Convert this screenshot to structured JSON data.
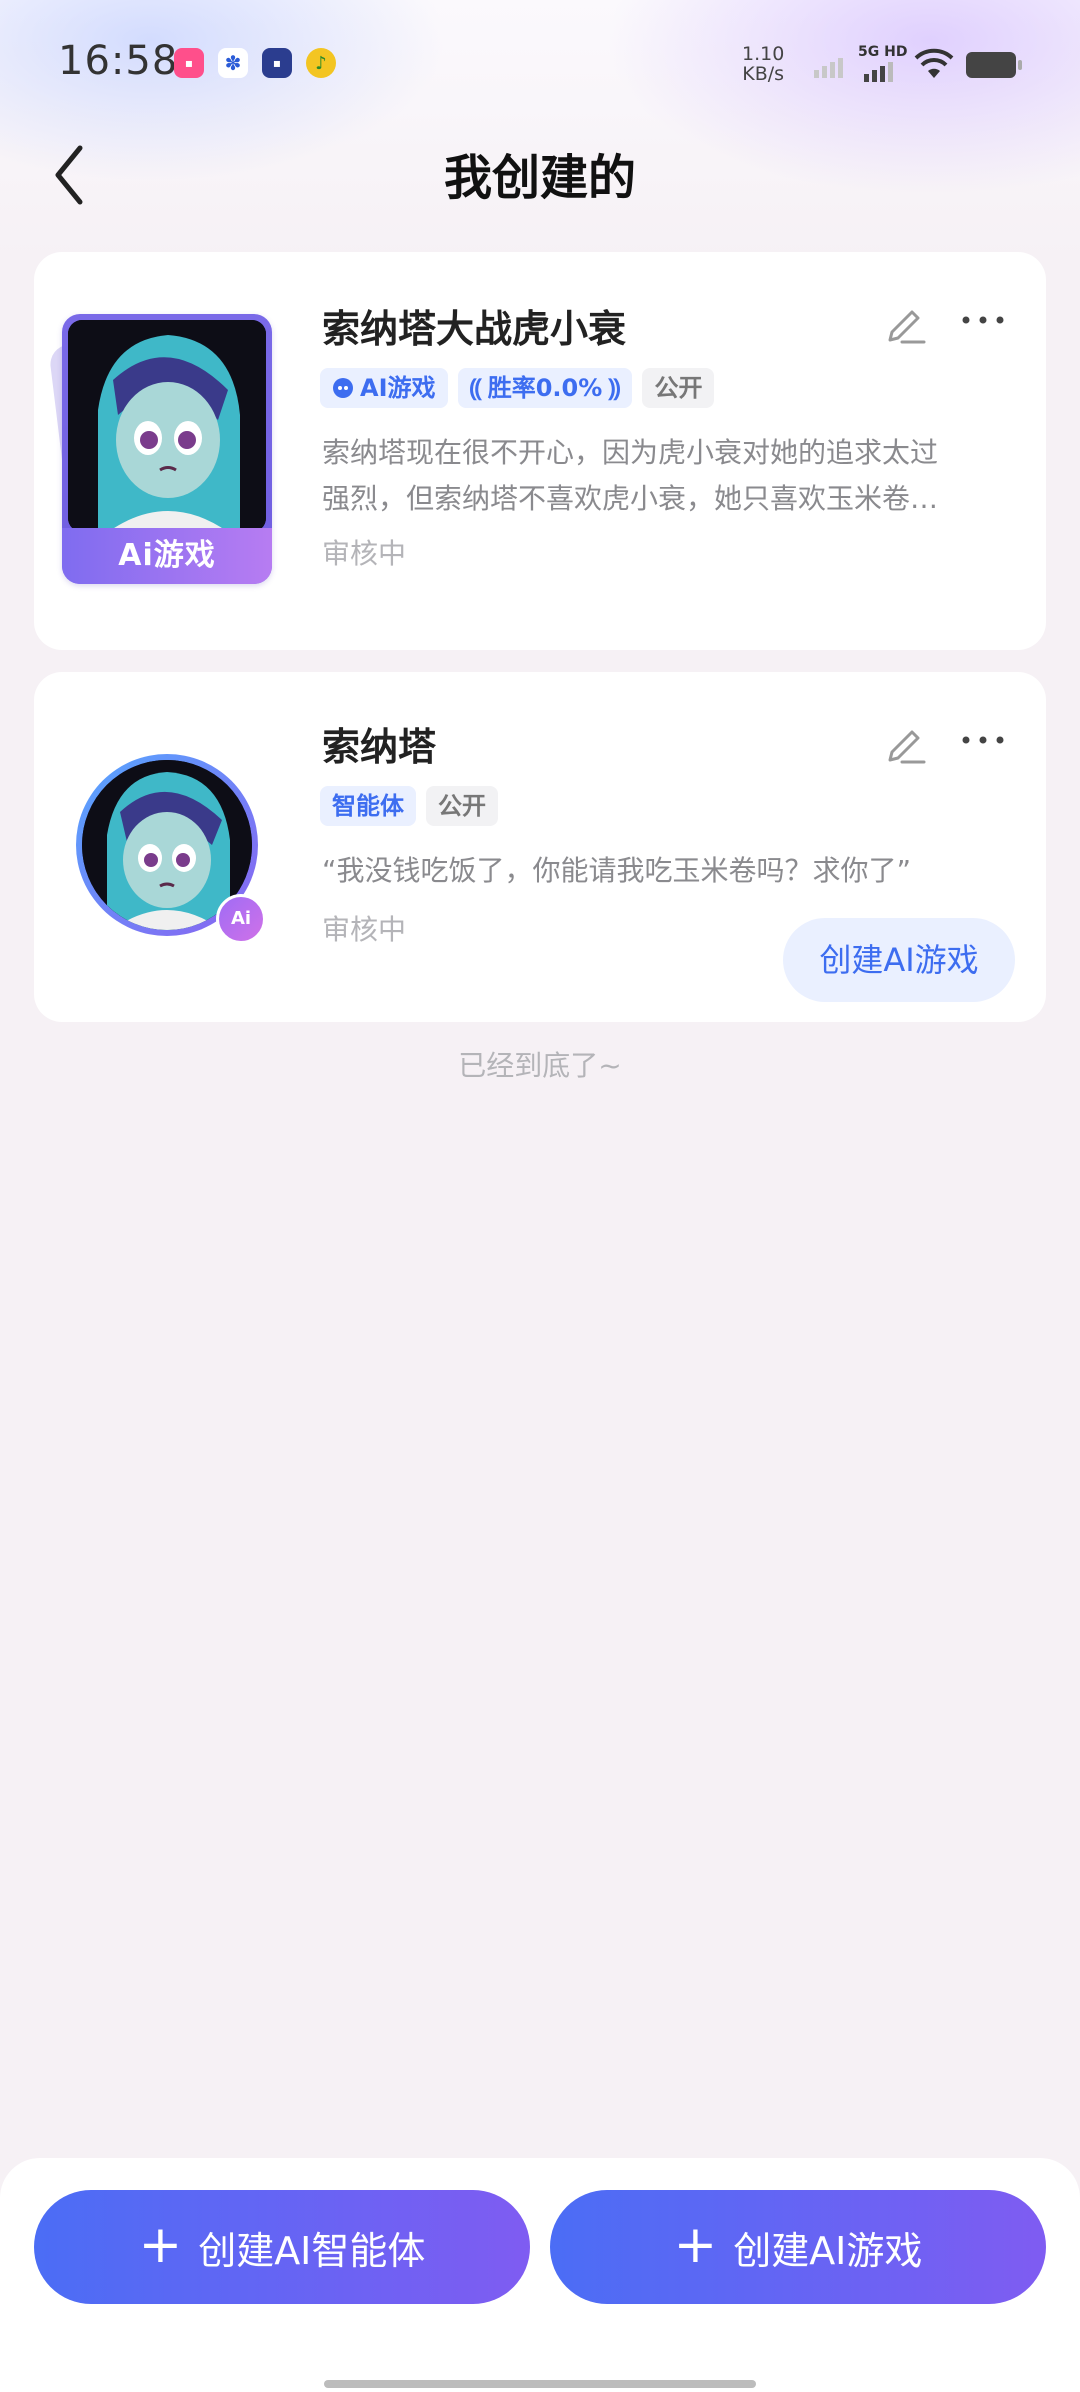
{
  "status_bar": {
    "time": "16:58",
    "net_speed_value": "1.10",
    "net_speed_unit": "KB/s",
    "network_label": "5G HD",
    "app_icons": [
      "lofter-icon",
      "baidu-icon",
      "tieba-icon",
      "qq-music-icon"
    ]
  },
  "header": {
    "title": "我创建的",
    "back_icon": "chevron-left-icon"
  },
  "items": [
    {
      "title": "索纳塔大战虎小衰",
      "cover_label": "Ai游戏",
      "tags": [
        "AI游戏",
        "胜率0.0%",
        "公开"
      ],
      "description": "索纳塔现在很不开心，因为虎小衰对她的追求太过强烈，但索纳塔不喜欢虎小衰，她只喜欢玉米卷…",
      "description_line1": "索纳塔现在很不开心，因为虎小衰对她的追求太过",
      "description_line2": "强烈，但索纳塔不喜欢虎小衰，她只喜欢玉米卷…",
      "status": "审核中"
    },
    {
      "title": "索纳塔",
      "badge_label": "Ai",
      "tags": [
        "智能体",
        "公开"
      ],
      "description": "“我没钱吃饭了，你能请我吃玉米卷吗？求你了”",
      "status": "审核中",
      "action_label": "创建AI游戏"
    }
  ],
  "end_text": "已经到底了~",
  "bottom_actions": {
    "create_agent": "创建AI智能体",
    "create_game": "创建AI游戏",
    "plus_symbol": "+"
  },
  "colors": {
    "accent_blue": "#3d6df0",
    "button_gradient_start": "#4b6df5",
    "button_gradient_end": "#7f5cf2",
    "background": "#f6f1f5"
  }
}
